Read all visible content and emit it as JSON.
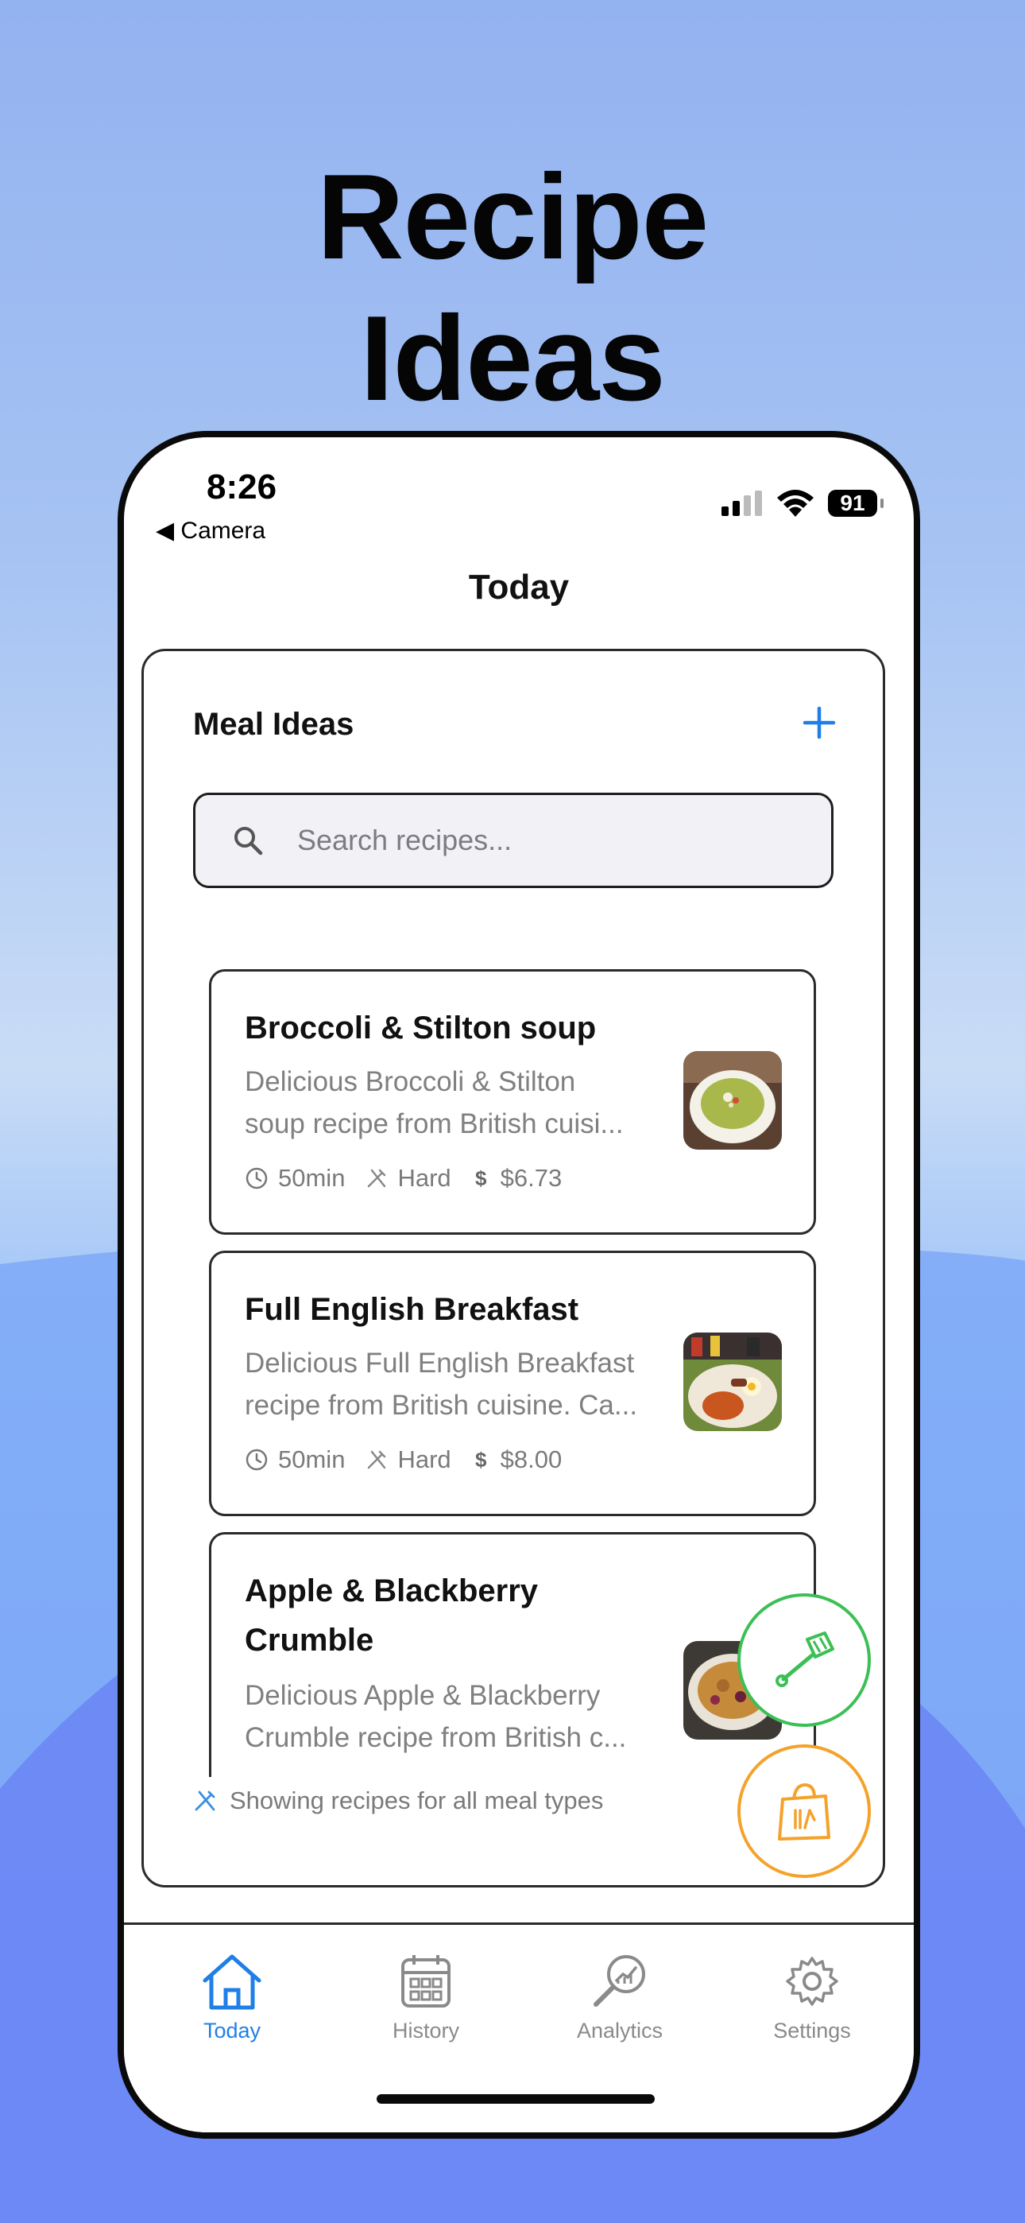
{
  "hero": {
    "line1": "Recipe",
    "line2": "Ideas"
  },
  "status_bar": {
    "time": "8:26",
    "back_label": "◀ Camera",
    "battery": "91"
  },
  "nav": {
    "title": "Today"
  },
  "meal_ideas": {
    "title": "Meal Ideas",
    "add_icon": "plus-icon",
    "search_placeholder": "Search recipes...",
    "footer_note": "Showing recipes for all meal types"
  },
  "recipes": [
    {
      "title": "Broccoli & Stilton soup",
      "desc_line1": "Delicious Broccoli & Stilton",
      "desc_line2": "soup recipe from British cuisi...",
      "time": "50min",
      "difficulty": "Hard",
      "cost": "$6.73",
      "image": "soup-photo"
    },
    {
      "title": "Full English Breakfast",
      "desc_line1": "Delicious Full English Breakfast",
      "desc_line2": "recipe from British cuisine. Ca...",
      "time": "50min",
      "difficulty": "Hard",
      "cost": "$8.00",
      "image": "breakfast-photo"
    },
    {
      "title_line1": "Apple & Blackberry",
      "title_line2": "Crumble",
      "desc_line1": "Delicious Apple & Blackberry",
      "desc_line2": "Crumble recipe from British c...",
      "image": "crumble-photo"
    }
  ],
  "fabs": {
    "cook": "spatula-icon",
    "shop": "shopping-bag-icon"
  },
  "tabs": [
    {
      "label": "Today",
      "icon": "home-icon",
      "active": true
    },
    {
      "label": "History",
      "icon": "calendar-icon",
      "active": false
    },
    {
      "label": "Analytics",
      "icon": "analytics-icon",
      "active": false
    },
    {
      "label": "Settings",
      "icon": "gear-icon",
      "active": false
    }
  ],
  "colors": {
    "accent_blue": "#1f7fe6",
    "fab_green": "#3cbf55",
    "fab_orange": "#f4a22a"
  }
}
